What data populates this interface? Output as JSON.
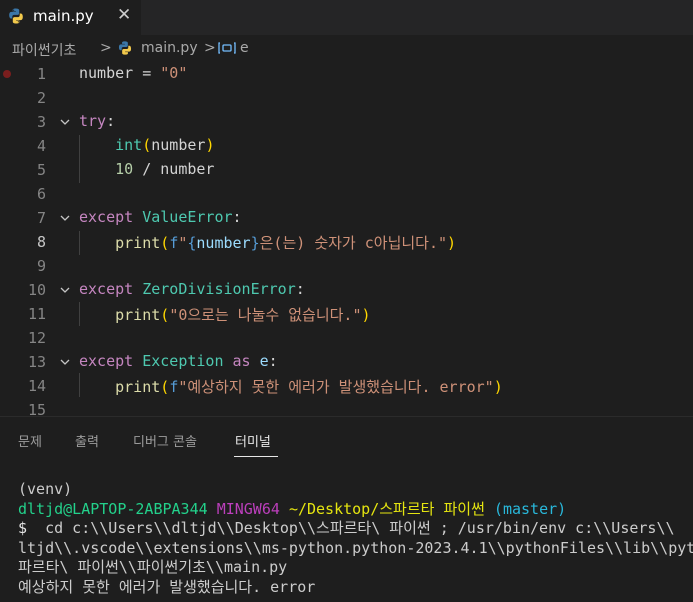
{
  "tab": {
    "label": "main.py",
    "close": "✕",
    "icon": "python-icon"
  },
  "breadcrumb": {
    "folder": "파이썬기초",
    "sep": ">",
    "file": "main.py",
    "symbol": "e"
  },
  "editor": {
    "lines": [
      {
        "n": "1"
      },
      {
        "n": "2"
      },
      {
        "n": "3"
      },
      {
        "n": "4"
      },
      {
        "n": "5"
      },
      {
        "n": "6"
      },
      {
        "n": "7"
      },
      {
        "n": "8"
      },
      {
        "n": "9"
      },
      {
        "n": "10"
      },
      {
        "n": "11"
      },
      {
        "n": "12"
      },
      {
        "n": "13"
      },
      {
        "n": "14"
      },
      {
        "n": "15"
      }
    ],
    "tokens": {
      "l1_var": "number",
      "l1_eq": " = ",
      "l1_str": "\"0\"",
      "l3_try": "try",
      "l3_colon": ":",
      "l4_fn": "int",
      "l4_p1": "(",
      "l4_var": "number",
      "l4_p2": ")",
      "l5_num": "10",
      "l5_op": " / ",
      "l5_var": "number",
      "l7_kw": "except",
      "l7_cls": "ValueError",
      "l7_colon": ":",
      "l8_fn": "print",
      "l8_p1": "(",
      "l8_f": "f",
      "l8_q1": "\"",
      "l8_b1": "{",
      "l8_var": "number",
      "l8_b2": "}",
      "l8_str": "은(는) 숫자가 c아닙니다.\"",
      "l8_p2": ")",
      "l10_kw": "except",
      "l10_cls": "ZeroDivisionError",
      "l10_colon": ":",
      "l11_fn": "print",
      "l11_p1": "(",
      "l11_str": "\"0으로는 나눌수 없습니다.\"",
      "l11_p2": ")",
      "l13_kw": "except",
      "l13_cls": "Exception",
      "l13_as": "as",
      "l13_var": "e",
      "l13_colon": ":",
      "l14_fn": "print",
      "l14_p1": "(",
      "l14_f": "f",
      "l14_str": "\"예상하지 못한 에러가 발생했습니다. error\"",
      "l14_p2": ")"
    }
  },
  "panel": {
    "tabs": [
      "문제",
      "출력",
      "디버그 콘솔",
      "터미널"
    ],
    "active_tab": "터미널"
  },
  "terminal": {
    "venv": "(venv)",
    "user": "dltjd@LAPTOP-2ABPA344",
    "shell": "MINGW64",
    "path": "~/Desktop/스파르타 파이썬",
    "branch": "(master)",
    "prompt": "$",
    "cmd_line1": "  cd c:\\\\Users\\\\dltjd\\\\Desktop\\\\스파르타\\ 파이썬 ; /usr/bin/env c:\\\\Users\\\\",
    "cmd_line2": "ltjd\\\\.vscode\\\\extensions\\\\ms-python.python-2023.4.1\\\\pythonFiles\\\\lib\\\\pyt",
    "cmd_line3": "파르타\\ 파이썬\\\\파이썬기초\\\\main.py",
    "output": "예상하지 못한 에러가 발생했습니다. error"
  },
  "colors": {
    "background": "#1e1e1e",
    "keyword": "#c586c0",
    "string": "#ce9178",
    "class": "#4ec9b0",
    "function": "#dcdcaa",
    "variable": "#9cdcfe"
  }
}
